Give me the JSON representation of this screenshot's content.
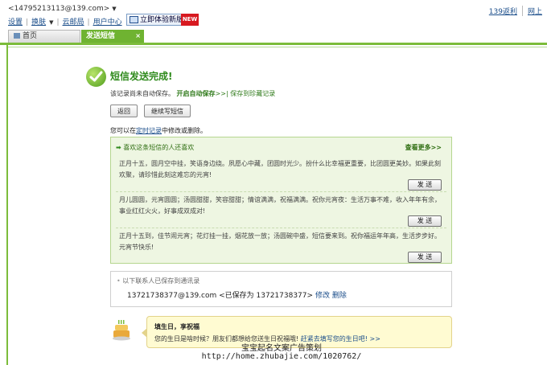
{
  "header": {
    "user_email": "<14795213113@139.com>",
    "top_links": [
      "139返利",
      "网上"
    ],
    "menu": {
      "settings": "设置",
      "skin": "换肤",
      "cloud_post": "云邮局",
      "user_center": "用户中心"
    },
    "promo_button": "立即体验新版",
    "new_badge": "NEW"
  },
  "tabs": {
    "home": "首页",
    "active": "发送短信",
    "close_glyph": "×"
  },
  "result": {
    "title": "短信发送完成!",
    "not_saved_text": "该记录尚未自动保存。",
    "enable_autosave": "开启自动保存",
    "enable_autosave_suffix": ">>|",
    "save_to_favorites": "保存到珍藏记录",
    "back_button": "返回",
    "continue_button": "继续写短信",
    "hint_prefix": "您可以在",
    "hint_link": "定时记录",
    "hint_suffix": "中修改或删除。"
  },
  "recommend": {
    "header": "喜欢这条短信的人还喜欢",
    "more_link": "查看更多>>",
    "send_label": "发 送",
    "messages": [
      "正月十五，圆月空中挂，笑语身边绕。夙愿心中藏，团圆时光少。扮什么比幸福更重要，比团圆更美妙。如果此刻欢聚，请珍惜此刻这难忘的元宵!",
      "月儿圆圆，元宵圆圆；汤圆甜甜，笑容甜甜；情谊满满，祝福满满。祝你元宵夜：生活万事不难，收入年年有余，事业红红火火，好事成双成对!",
      "正月十五到，佳节闹元宵；花灯挂一挂，烟花放一放；汤圆碗中盛，短信要来到。祝你福运年年高，生活步步好。元宵节快乐!"
    ]
  },
  "contacts": {
    "title": "以下联系人已保存到通讯录",
    "email": "13721738377@139.com",
    "saved_as": "<已保存为 13721738377>",
    "edit": "修改",
    "delete": "删除"
  },
  "birthday": {
    "title": "填生日，享祝福",
    "text": "您的生日是啥时候？朋友们都想给您送生日祝福哦!",
    "link": "赶紧去填写您的生日吧! >>"
  },
  "watermark": {
    "line1": "宝宝起名文案广告策划",
    "line2": "http://home.zhubajie.com/1020762/"
  },
  "colors": {
    "accent_green": "#7cbc3b",
    "title_green": "#2f8a1c",
    "link_blue": "#1a4d8a",
    "new_red": "#d71920"
  }
}
